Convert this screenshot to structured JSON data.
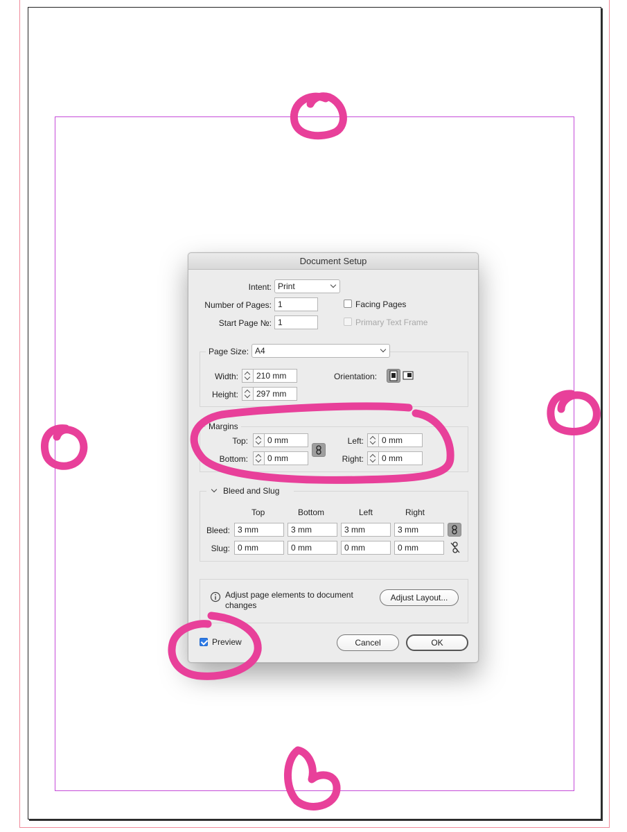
{
  "dialog": {
    "title": "Document Setup",
    "intent": {
      "label": "Intent:",
      "value": "Print"
    },
    "number_of_pages": {
      "label": "Number of Pages:",
      "value": "1"
    },
    "start_page": {
      "label": "Start Page №:",
      "value": "1"
    },
    "facing_pages": {
      "label": "Facing Pages",
      "checked": false
    },
    "primary_text_frame": {
      "label": "Primary Text Frame",
      "checked": false,
      "disabled": true
    },
    "page_size": {
      "label": "Page Size:",
      "value": "A4"
    },
    "width": {
      "label": "Width:",
      "value": "210 mm"
    },
    "height": {
      "label": "Height:",
      "value": "297 mm"
    },
    "orientation": {
      "label": "Orientation:",
      "selected": "portrait"
    },
    "margins": {
      "title": "Margins",
      "top": {
        "label": "Top:",
        "value": "0 mm"
      },
      "bottom": {
        "label": "Bottom:",
        "value": "0 mm"
      },
      "left": {
        "label": "Left:",
        "value": "0 mm"
      },
      "right": {
        "label": "Right:",
        "value": "0 mm"
      }
    },
    "bleed_slug": {
      "title": "Bleed and Slug",
      "columns": [
        "Top",
        "Bottom",
        "Left",
        "Right"
      ],
      "bleed": {
        "label": "Bleed:",
        "values": [
          "3 mm",
          "3 mm",
          "3 mm",
          "3 mm"
        ]
      },
      "slug": {
        "label": "Slug:",
        "values": [
          "0 mm",
          "0 mm",
          "0 mm",
          "0 mm"
        ]
      }
    },
    "adjust": {
      "text": "Adjust page elements to document changes",
      "button": "Adjust Layout..."
    },
    "preview": {
      "label": "Preview",
      "checked": true
    },
    "cancel": "Cancel",
    "ok": "OK"
  },
  "colors": {
    "annotation": "#e8409a",
    "margin_guide": "#c44ad8",
    "bleed_guide": "#f08a9a",
    "checkbox_accent": "#2e7be6"
  }
}
